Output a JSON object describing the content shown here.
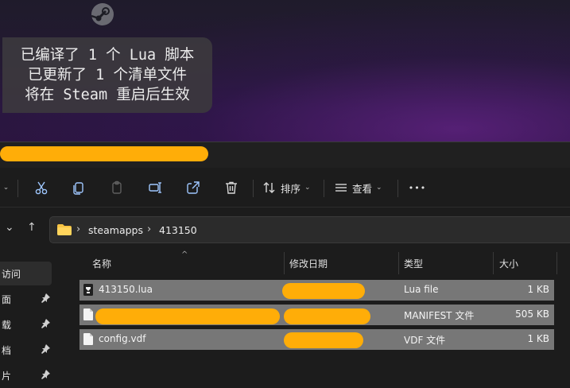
{
  "notification": {
    "app_icon": "steam-icon",
    "lines": [
      "已编译了 1 个 Lua 脚本",
      "已更新了 1 个清单文件",
      "将在 Steam 重启后生效"
    ]
  },
  "toolbar": {
    "icons": [
      "cut-icon",
      "copy-icon",
      "paste-icon",
      "rename-icon",
      "share-icon",
      "delete-icon"
    ],
    "sort_label": "排序",
    "view_label": "查看",
    "more_label": "•••"
  },
  "address": {
    "segments": [
      "steamapps",
      "413150"
    ]
  },
  "sidebar": {
    "items": [
      {
        "label": "访问",
        "pinned": false
      },
      {
        "label": "面",
        "pinned": true
      },
      {
        "label": "载",
        "pinned": true
      },
      {
        "label": "档",
        "pinned": true
      },
      {
        "label": "片",
        "pinned": true
      }
    ]
  },
  "columns": {
    "name": "名称",
    "modified": "修改日期",
    "type": "类型",
    "size": "大小"
  },
  "files": [
    {
      "name": "413150.lua",
      "icon": "lua-file-icon",
      "type": "Lua file",
      "size": "1 KB"
    },
    {
      "name": "",
      "icon": "manifest-file-icon",
      "type": "MANIFEST 文件",
      "size": "505 KB"
    },
    {
      "name": "config.vdf",
      "icon": "vdf-file-icon",
      "type": "VDF 文件",
      "size": "1 KB"
    }
  ],
  "colors": {
    "redaction": "#ffad08",
    "selected_row": "#777777",
    "folder": "#f6c343"
  }
}
